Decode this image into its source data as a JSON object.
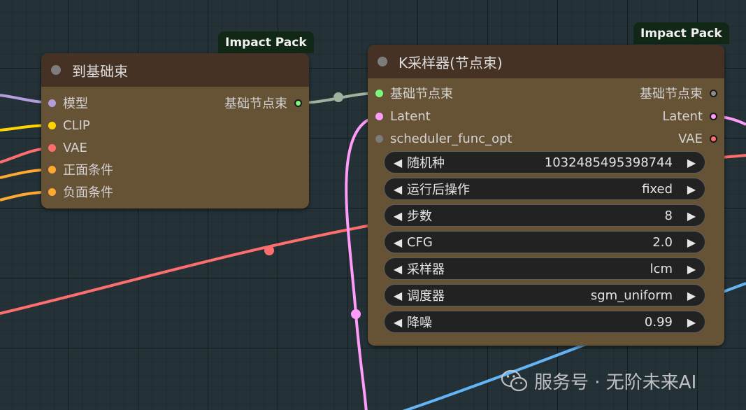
{
  "colors": {
    "model": "#b39ddb",
    "clip": "#ffd500",
    "vae": "#ff6e6e",
    "conditioning": "#ffa931",
    "latent": "#ff9cf9",
    "basic_pipe": "#7cf67c",
    "wire_pipe": "#9eb29e",
    "wire_vae": "#ff6e6e",
    "wire_latent": "#ff9cf9",
    "wire_blue": "#64b5f6"
  },
  "left_node": {
    "badge": "Impact Pack",
    "title": "到基础束",
    "inputs": [
      {
        "label": "模型",
        "type": "model"
      },
      {
        "label": "CLIP",
        "type": "clip"
      },
      {
        "label": "VAE",
        "type": "vae"
      },
      {
        "label": "正面条件",
        "type": "conditioning"
      },
      {
        "label": "负面条件",
        "type": "conditioning"
      }
    ],
    "outputs": [
      {
        "label": "基础节点束",
        "type": "basic_pipe"
      }
    ]
  },
  "right_node": {
    "badge": "Impact Pack",
    "title": "K采样器(节点束)",
    "inputs": [
      {
        "label": "基础节点束",
        "type": "basic_pipe"
      },
      {
        "label": "Latent",
        "type": "latent"
      },
      {
        "label": "scheduler_func_opt",
        "type": "optional"
      }
    ],
    "outputs": [
      {
        "label": "基础节点束",
        "type": "basic_pipe_out"
      },
      {
        "label": "Latent",
        "type": "latent"
      },
      {
        "label": "VAE",
        "type": "vae"
      }
    ],
    "widgets": [
      {
        "label": "随机种",
        "value": "1032485495398744"
      },
      {
        "label": "运行后操作",
        "value": "fixed"
      },
      {
        "label": "步数",
        "value": "8"
      },
      {
        "label": "CFG",
        "value": "2.0"
      },
      {
        "label": "采样器",
        "value": "lcm"
      },
      {
        "label": "调度器",
        "value": "sgm_uniform"
      },
      {
        "label": "降噪",
        "value": "0.99"
      }
    ]
  },
  "arrows": {
    "left": "◀",
    "right": "▶"
  },
  "watermark": {
    "text": "服务号 · 无阶未来AI",
    "icon": "wechat-icon"
  }
}
